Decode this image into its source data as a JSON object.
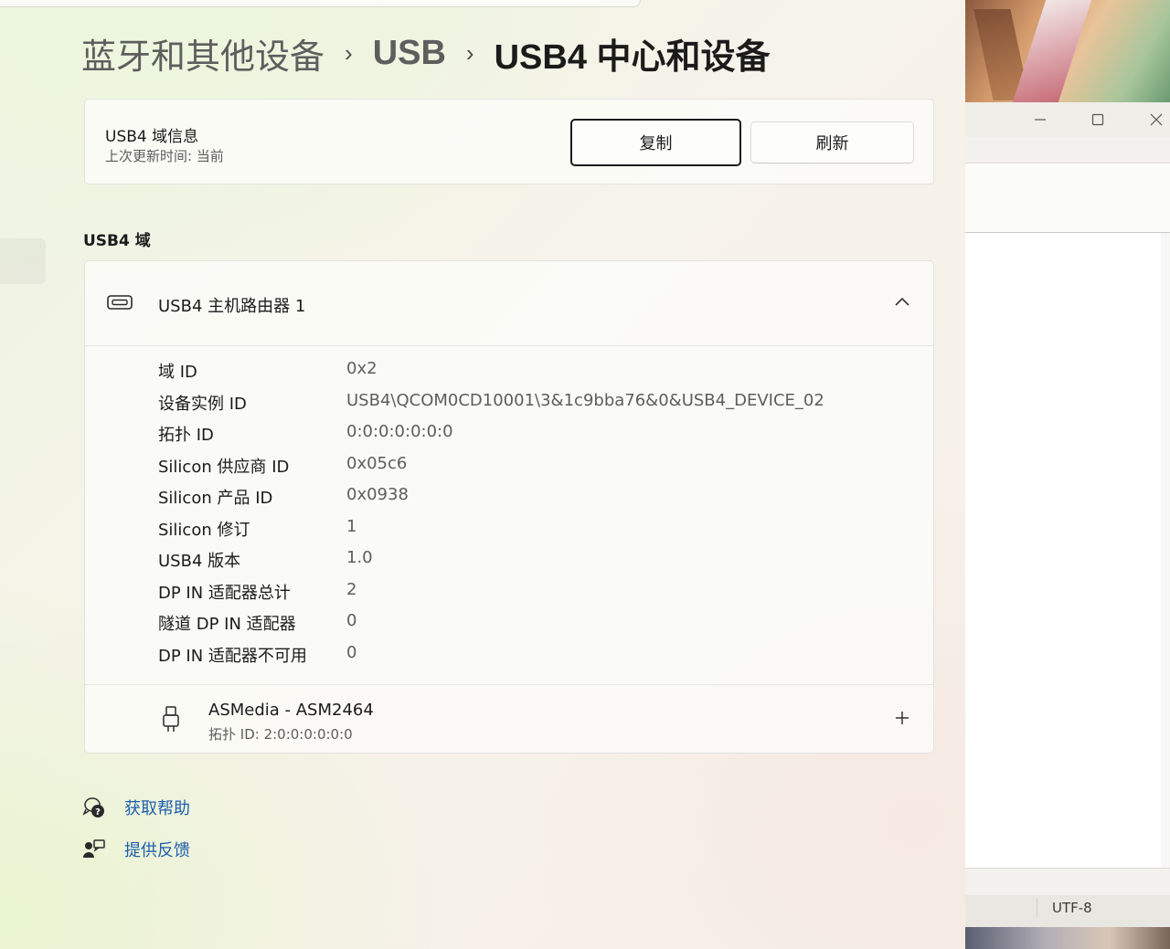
{
  "breadcrumb": {
    "item1": "蓝牙和其他设备",
    "item2": "USB",
    "current": "USB4 中心和设备",
    "separator": "›"
  },
  "info_card": {
    "title": "USB4 域信息",
    "last_updated": "上次更新时间:  当前",
    "copy_label": "复制",
    "refresh_label": "刷新"
  },
  "section": {
    "label": "USB4 域"
  },
  "router": {
    "title": "USB4 主机路由器 1",
    "properties": [
      {
        "label": "域 ID",
        "value": "0x2"
      },
      {
        "label": "设备实例 ID",
        "value": "USB4\\QCOM0CD10001\\3&1c9bba76&0&USB4_DEVICE_02"
      },
      {
        "label": "拓扑 ID",
        "value": "0:0:0:0:0:0:0"
      },
      {
        "label": "Silicon 供应商 ID",
        "value": "0x05c6"
      },
      {
        "label": "Silicon 产品 ID",
        "value": "0x0938"
      },
      {
        "label": "Silicon 修订",
        "value": "1"
      },
      {
        "label": "USB4 版本",
        "value": "1.0"
      },
      {
        "label": "DP IN 适配器总计",
        "value": "2"
      },
      {
        "label": "隧道 DP IN 适配器",
        "value": "0"
      },
      {
        "label": "DP IN 适配器不可用",
        "value": "0"
      }
    ],
    "device": {
      "name": "ASMedia - ASM2464",
      "topology": "拓扑 ID:  2:0:0:0:0:0:0"
    }
  },
  "links": {
    "help": "获取帮助",
    "feedback": "提供反馈"
  },
  "notepad": {
    "encoding": "UTF-8"
  },
  "colors": {
    "link": "#1d5fae",
    "text": "#1b1b1b",
    "secondary_text": "#5d5d5d"
  },
  "icons": [
    "usb4-router-icon",
    "chevron-up-icon",
    "usb-plug-icon",
    "plus-icon",
    "help-icon",
    "feedback-icon",
    "minimize-icon",
    "maximize-icon",
    "close-icon"
  ]
}
